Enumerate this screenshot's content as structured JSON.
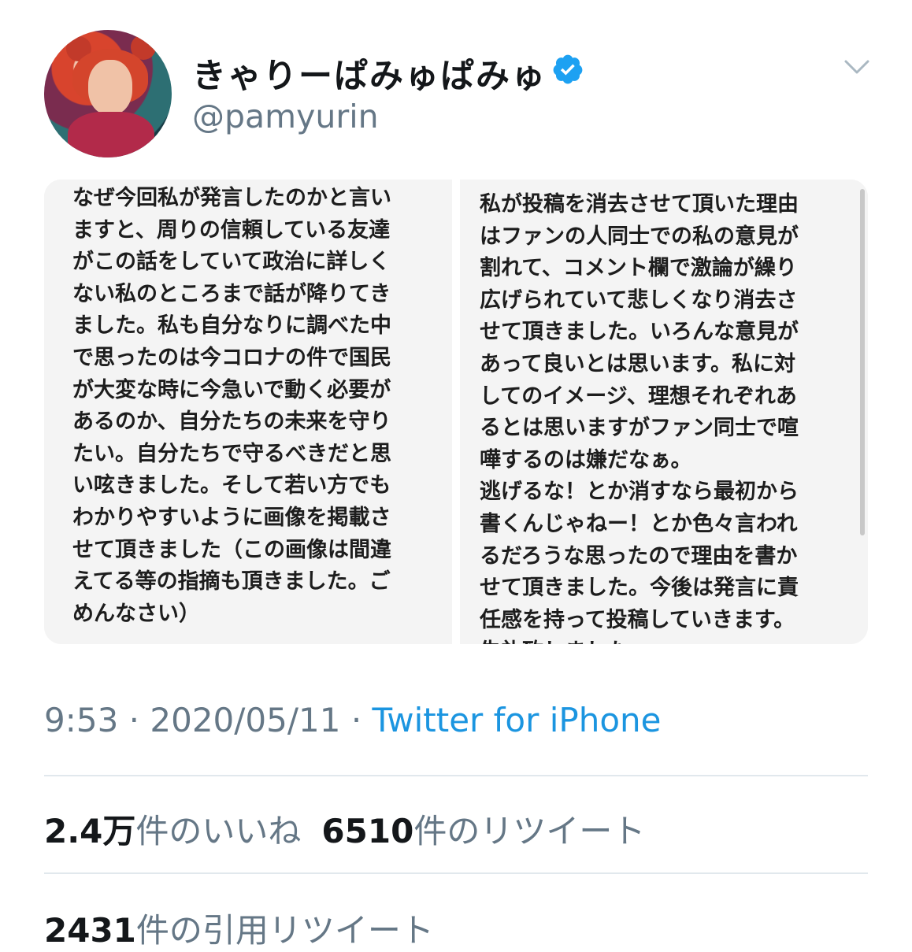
{
  "tweet": {
    "display_name": "きゃりーぱみゅぱみゅ",
    "handle": "@pamyurin",
    "verified_icon": "verified-badge-icon",
    "menu_icon": "chevron-down-icon",
    "brand_color": "#1da1f2"
  },
  "media": {
    "left_text": "なぜ今回私が発言したのかと言い\nますと、周りの信頼している友達\nがこの話をしていて政治に詳しく\nない私のところまで話が降りてき\nました。私も自分なりに調べた中\nで思ったのは今コロナの件で国民\nが大変な時に今急いで動く必要が\nあるのか、自分たちの未来を守り\nたい。自分たちで守るべきだと思\nい呟きました。そして若い方でも\nわかりやすいように画像を掲載さ\nせて頂きました（この画像は間違\nえてる等の指摘も頂きました。ご\nめんなさい）",
    "right_text": "私が投稿を消去させて頂いた理由\nはファンの人同士での私の意見が\n割れて、コメント欄で激論が繰り\n広げられていて悲しくなり消去さ\nせて頂きました。いろんな意見が\nあって良いとは思います。私に対\nしてのイメージ、理想それぞれあ\nるとは思いますがファン同士で喧\n嘩するのは嫌だなぁ。\n逃げるな！とか消すなら最初から\n書くんじゃねー！とか色々言われ\nるだろうな思ったので理由を書か\nせて頂きました。今後は発言に責\n任感を持って投稿していきます。\n失礼致しました。"
  },
  "meta": {
    "time": "9:53",
    "separator": " · ",
    "date": "2020/05/11",
    "source": "Twitter for iPhone",
    "source_color": "#1b95e0"
  },
  "stats": {
    "likes_count": "2.4万",
    "likes_label": "件のいいね",
    "retweets_count": "6510",
    "retweets_label": "件のリツイート",
    "quotes_count": "2431",
    "quotes_label": "件の引用リツイート"
  }
}
